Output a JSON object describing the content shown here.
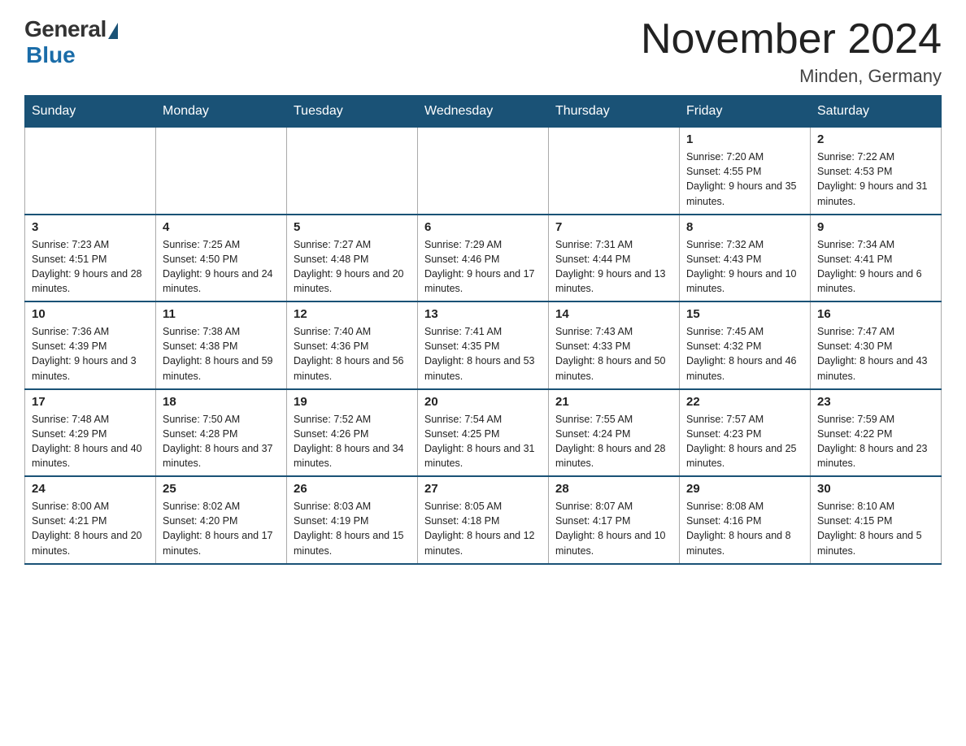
{
  "header": {
    "logo": {
      "general": "General",
      "blue": "Blue"
    },
    "title": "November 2024",
    "location": "Minden, Germany"
  },
  "days_of_week": [
    "Sunday",
    "Monday",
    "Tuesday",
    "Wednesday",
    "Thursday",
    "Friday",
    "Saturday"
  ],
  "weeks": [
    [
      {
        "day": "",
        "info": ""
      },
      {
        "day": "",
        "info": ""
      },
      {
        "day": "",
        "info": ""
      },
      {
        "day": "",
        "info": ""
      },
      {
        "day": "",
        "info": ""
      },
      {
        "day": "1",
        "info": "Sunrise: 7:20 AM\nSunset: 4:55 PM\nDaylight: 9 hours and 35 minutes."
      },
      {
        "day": "2",
        "info": "Sunrise: 7:22 AM\nSunset: 4:53 PM\nDaylight: 9 hours and 31 minutes."
      }
    ],
    [
      {
        "day": "3",
        "info": "Sunrise: 7:23 AM\nSunset: 4:51 PM\nDaylight: 9 hours and 28 minutes."
      },
      {
        "day": "4",
        "info": "Sunrise: 7:25 AM\nSunset: 4:50 PM\nDaylight: 9 hours and 24 minutes."
      },
      {
        "day": "5",
        "info": "Sunrise: 7:27 AM\nSunset: 4:48 PM\nDaylight: 9 hours and 20 minutes."
      },
      {
        "day": "6",
        "info": "Sunrise: 7:29 AM\nSunset: 4:46 PM\nDaylight: 9 hours and 17 minutes."
      },
      {
        "day": "7",
        "info": "Sunrise: 7:31 AM\nSunset: 4:44 PM\nDaylight: 9 hours and 13 minutes."
      },
      {
        "day": "8",
        "info": "Sunrise: 7:32 AM\nSunset: 4:43 PM\nDaylight: 9 hours and 10 minutes."
      },
      {
        "day": "9",
        "info": "Sunrise: 7:34 AM\nSunset: 4:41 PM\nDaylight: 9 hours and 6 minutes."
      }
    ],
    [
      {
        "day": "10",
        "info": "Sunrise: 7:36 AM\nSunset: 4:39 PM\nDaylight: 9 hours and 3 minutes."
      },
      {
        "day": "11",
        "info": "Sunrise: 7:38 AM\nSunset: 4:38 PM\nDaylight: 8 hours and 59 minutes."
      },
      {
        "day": "12",
        "info": "Sunrise: 7:40 AM\nSunset: 4:36 PM\nDaylight: 8 hours and 56 minutes."
      },
      {
        "day": "13",
        "info": "Sunrise: 7:41 AM\nSunset: 4:35 PM\nDaylight: 8 hours and 53 minutes."
      },
      {
        "day": "14",
        "info": "Sunrise: 7:43 AM\nSunset: 4:33 PM\nDaylight: 8 hours and 50 minutes."
      },
      {
        "day": "15",
        "info": "Sunrise: 7:45 AM\nSunset: 4:32 PM\nDaylight: 8 hours and 46 minutes."
      },
      {
        "day": "16",
        "info": "Sunrise: 7:47 AM\nSunset: 4:30 PM\nDaylight: 8 hours and 43 minutes."
      }
    ],
    [
      {
        "day": "17",
        "info": "Sunrise: 7:48 AM\nSunset: 4:29 PM\nDaylight: 8 hours and 40 minutes."
      },
      {
        "day": "18",
        "info": "Sunrise: 7:50 AM\nSunset: 4:28 PM\nDaylight: 8 hours and 37 minutes."
      },
      {
        "day": "19",
        "info": "Sunrise: 7:52 AM\nSunset: 4:26 PM\nDaylight: 8 hours and 34 minutes."
      },
      {
        "day": "20",
        "info": "Sunrise: 7:54 AM\nSunset: 4:25 PM\nDaylight: 8 hours and 31 minutes."
      },
      {
        "day": "21",
        "info": "Sunrise: 7:55 AM\nSunset: 4:24 PM\nDaylight: 8 hours and 28 minutes."
      },
      {
        "day": "22",
        "info": "Sunrise: 7:57 AM\nSunset: 4:23 PM\nDaylight: 8 hours and 25 minutes."
      },
      {
        "day": "23",
        "info": "Sunrise: 7:59 AM\nSunset: 4:22 PM\nDaylight: 8 hours and 23 minutes."
      }
    ],
    [
      {
        "day": "24",
        "info": "Sunrise: 8:00 AM\nSunset: 4:21 PM\nDaylight: 8 hours and 20 minutes."
      },
      {
        "day": "25",
        "info": "Sunrise: 8:02 AM\nSunset: 4:20 PM\nDaylight: 8 hours and 17 minutes."
      },
      {
        "day": "26",
        "info": "Sunrise: 8:03 AM\nSunset: 4:19 PM\nDaylight: 8 hours and 15 minutes."
      },
      {
        "day": "27",
        "info": "Sunrise: 8:05 AM\nSunset: 4:18 PM\nDaylight: 8 hours and 12 minutes."
      },
      {
        "day": "28",
        "info": "Sunrise: 8:07 AM\nSunset: 4:17 PM\nDaylight: 8 hours and 10 minutes."
      },
      {
        "day": "29",
        "info": "Sunrise: 8:08 AM\nSunset: 4:16 PM\nDaylight: 8 hours and 8 minutes."
      },
      {
        "day": "30",
        "info": "Sunrise: 8:10 AM\nSunset: 4:15 PM\nDaylight: 8 hours and 5 minutes."
      }
    ]
  ]
}
